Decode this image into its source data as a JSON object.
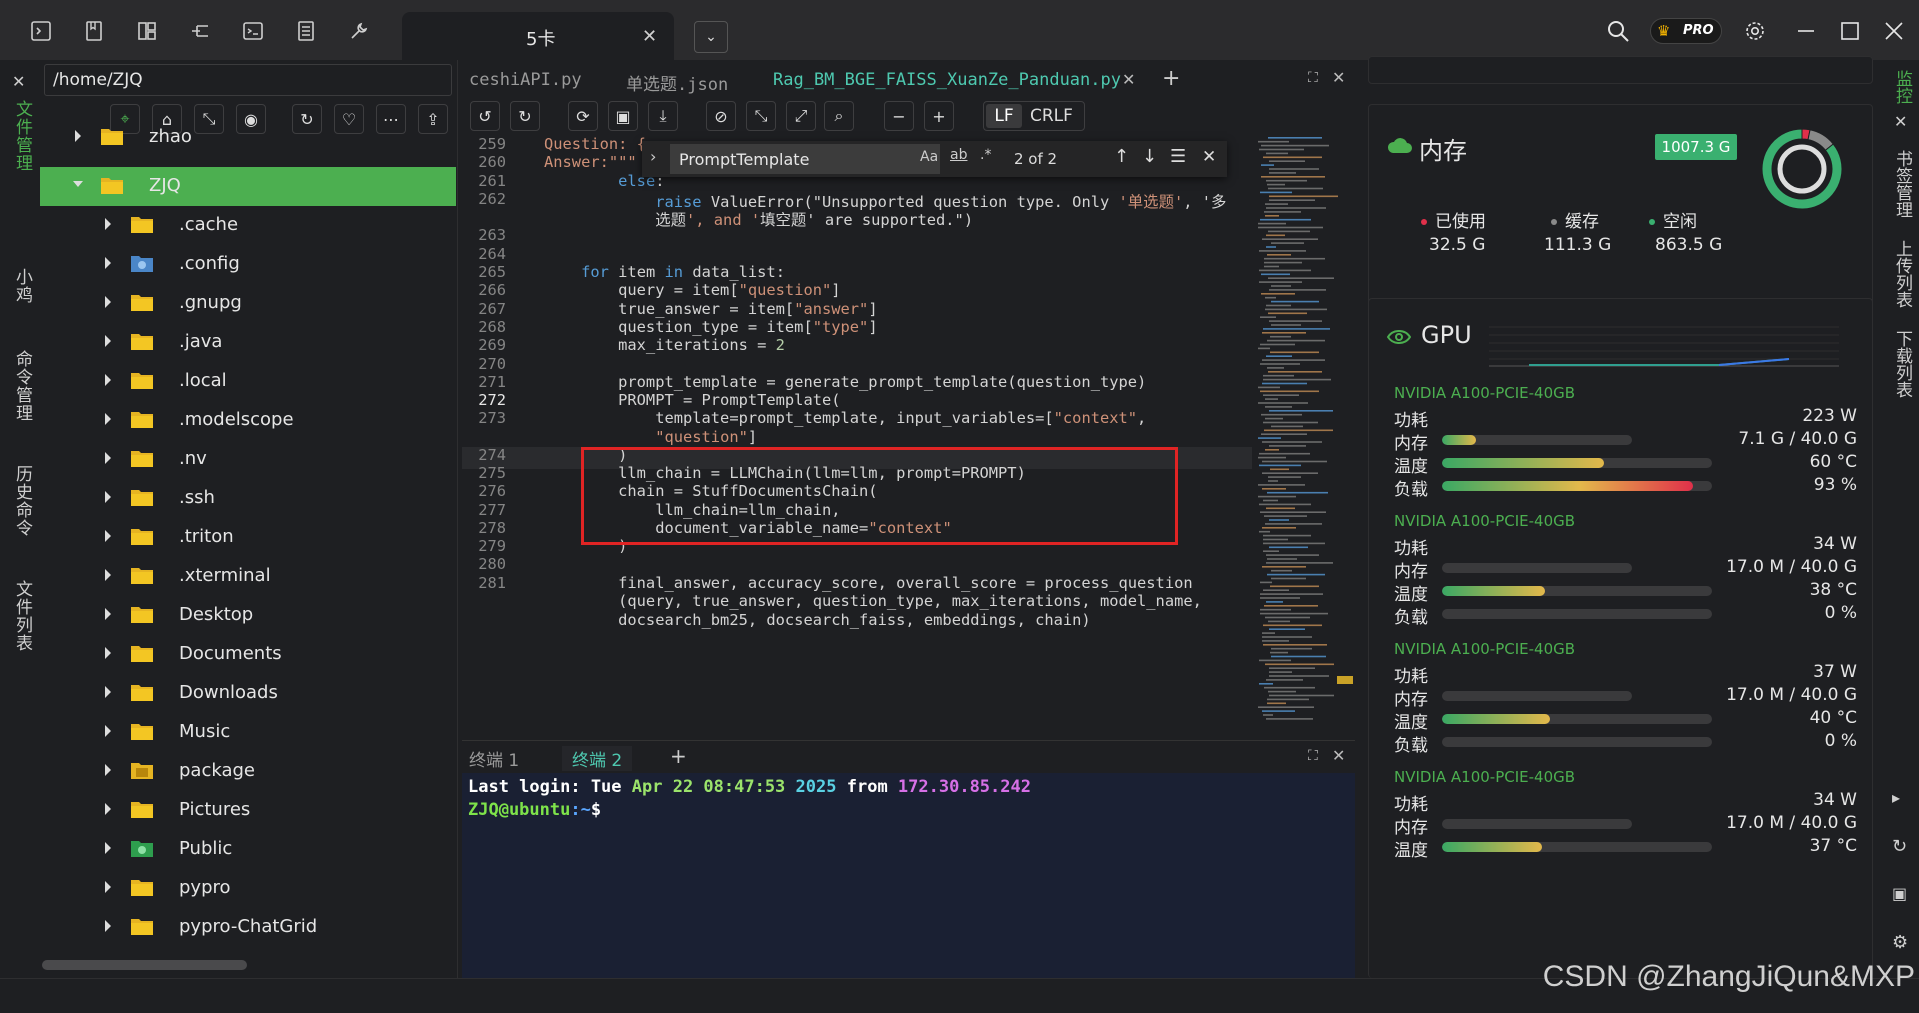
{
  "titlebar": {
    "tab_title": "5卡",
    "pro_badge": "PRO",
    "icons": [
      "terminal-icon",
      "bookmark-icon",
      "layout-icon",
      "tree-icon",
      "shell-icon",
      "list-icon",
      "wrench-icon"
    ]
  },
  "left_sidebar": {
    "items": [
      "文件管理",
      "小鸡",
      "命令管理",
      "历史命令",
      "文件列表"
    ]
  },
  "file_panel": {
    "path": "/home/ZJQ",
    "tree": [
      {
        "label": "zhao",
        "depth": 1,
        "expanded": false
      },
      {
        "label": "ZJQ",
        "depth": 1,
        "expanded": true,
        "selected": true
      },
      {
        "label": ".cache",
        "depth": 2
      },
      {
        "label": ".config",
        "depth": 2,
        "special": "gear"
      },
      {
        "label": ".gnupg",
        "depth": 2
      },
      {
        "label": ".java",
        "depth": 2
      },
      {
        "label": ".local",
        "depth": 2
      },
      {
        "label": ".modelscope",
        "depth": 2
      },
      {
        "label": ".nv",
        "depth": 2
      },
      {
        "label": ".ssh",
        "depth": 2
      },
      {
        "label": ".triton",
        "depth": 2
      },
      {
        "label": ".xterminal",
        "depth": 2
      },
      {
        "label": "Desktop",
        "depth": 2
      },
      {
        "label": "Documents",
        "depth": 2
      },
      {
        "label": "Downloads",
        "depth": 2
      },
      {
        "label": "Music",
        "depth": 2
      },
      {
        "label": "package",
        "depth": 2,
        "special": "pkg"
      },
      {
        "label": "Pictures",
        "depth": 2
      },
      {
        "label": "Public",
        "depth": 2,
        "special": "public"
      },
      {
        "label": "pypro",
        "depth": 2
      },
      {
        "label": "pypro-ChatGrid",
        "depth": 2
      }
    ]
  },
  "editor": {
    "tabs": [
      {
        "label": "ceshiAPI.py",
        "active": false
      },
      {
        "label": "单选题.json",
        "active": false
      },
      {
        "label": "Rag_BM_BGE_FAISS_XuanZe_Panduan.py",
        "active": true
      }
    ],
    "eol": {
      "lf": "LF",
      "crlf": "CRLF"
    },
    "find": {
      "query": "PromptTemplate",
      "count": "2 of 2",
      "opt_case": "Aa",
      "opt_word": "ab",
      "opt_regex": ".*"
    },
    "current_line": "272",
    "lines": [
      {
        "n": "259",
        "text": "Question: {"
      },
      {
        "n": "260",
        "text": "Answer:\"\"\""
      },
      {
        "n": "261",
        "text": "        else:"
      },
      {
        "n": "262",
        "text": "            raise ValueError(\"Unsupported question type. Only '单选题', '多"
      },
      {
        "n": "",
        "text": "            选题', and '填空题' are supported.\")"
      },
      {
        "n": "263",
        "text": ""
      },
      {
        "n": "264",
        "text": ""
      },
      {
        "n": "265",
        "text": "    for item in data_list:"
      },
      {
        "n": "266",
        "text": "        query = item[\"question\"]"
      },
      {
        "n": "267",
        "text": "        true_answer = item[\"answer\"]"
      },
      {
        "n": "268",
        "text": "        question_type = item[\"type\"]"
      },
      {
        "n": "269",
        "text": "        max_iterations = 2"
      },
      {
        "n": "270",
        "text": ""
      },
      {
        "n": "271",
        "text": "        prompt_template = generate_prompt_template(question_type)"
      },
      {
        "n": "272",
        "text": "        PROMPT = PromptTemplate("
      },
      {
        "n": "273",
        "text": "            template=prompt_template, input_variables=[\"context\","
      },
      {
        "n": "",
        "text": "            \"question\"]"
      },
      {
        "n": "274",
        "text": "        )"
      },
      {
        "n": "275",
        "text": "        llm_chain = LLMChain(llm=llm, prompt=PROMPT)"
      },
      {
        "n": "276",
        "text": "        chain = StuffDocumentsChain("
      },
      {
        "n": "277",
        "text": "            llm_chain=llm_chain,"
      },
      {
        "n": "278",
        "text": "            document_variable_name=\"context\""
      },
      {
        "n": "279",
        "text": "        )"
      },
      {
        "n": "280",
        "text": ""
      },
      {
        "n": "281",
        "text": "        final_answer, accuracy_score, overall_score = process_question"
      },
      {
        "n": "",
        "text": "        (query, true_answer, question_type, max_iterations, model_name,"
      },
      {
        "n": "",
        "text": "        docsearch_bm25, docsearch_faiss, embeddings, chain)"
      }
    ]
  },
  "terminal": {
    "tabs": [
      {
        "label": "终端",
        "num": "1",
        "active": false
      },
      {
        "label": "终端",
        "num": "2",
        "active": true
      }
    ],
    "login_prefix": "Last login: Tue ",
    "login_date": "Apr 22 08:47:53",
    "login_year": "2025",
    "login_from": " from ",
    "login_ip": "172.30.85.242",
    "prompt_user": "ZJQ@ubuntu",
    "prompt_path": ":~",
    "prompt_sym": "$"
  },
  "memory": {
    "title": "内存",
    "total": "1007.3 G",
    "used_label": "已使用",
    "used": "32.5 G",
    "cache_label": "缓存",
    "cache": "111.3 G",
    "free_label": "空闲",
    "free": "863.5 G",
    "colors": {
      "used": "#e0304a",
      "cache": "#8a8a8a",
      "free": "#3ab070"
    }
  },
  "gpu": {
    "title": "GPU",
    "cards": [
      {
        "name": "NVIDIA A100-PCIE-40GB",
        "power_label": "功耗",
        "power": "223 W",
        "mem_label": "内存",
        "mem": "7.1 G / 40.0 G",
        "mem_pct": 18,
        "temp_label": "温度",
        "temp": "60 °C",
        "temp_pct": 60,
        "load_label": "负载",
        "load": "93 %",
        "load_pct": 93
      },
      {
        "name": "NVIDIA A100-PCIE-40GB",
        "power_label": "功耗",
        "power": "34 W",
        "mem_label": "内存",
        "mem": "17.0 M / 40.0 G",
        "mem_pct": 0,
        "temp_label": "温度",
        "temp": "38 °C",
        "temp_pct": 38,
        "load_label": "负载",
        "load": "0 %",
        "load_pct": 0
      },
      {
        "name": "NVIDIA A100-PCIE-40GB",
        "power_label": "功耗",
        "power": "37 W",
        "mem_label": "内存",
        "mem": "17.0 M / 40.0 G",
        "mem_pct": 0,
        "temp_label": "温度",
        "temp": "40 °C",
        "temp_pct": 40,
        "load_label": "负载",
        "load": "0 %",
        "load_pct": 0
      },
      {
        "name": "NVIDIA A100-PCIE-40GB",
        "power_label": "功耗",
        "power": "34 W",
        "mem_label": "内存",
        "mem": "17.0 M / 40.0 G",
        "mem_pct": 0,
        "temp_label": "温度",
        "temp": "37 °C",
        "temp_pct": 37
      }
    ]
  },
  "right_sidebar": {
    "items": [
      "监控",
      "书签管理",
      "上传列表",
      "下载列表"
    ]
  },
  "watermark": "CSDN @ZhangJiQun&MXP"
}
